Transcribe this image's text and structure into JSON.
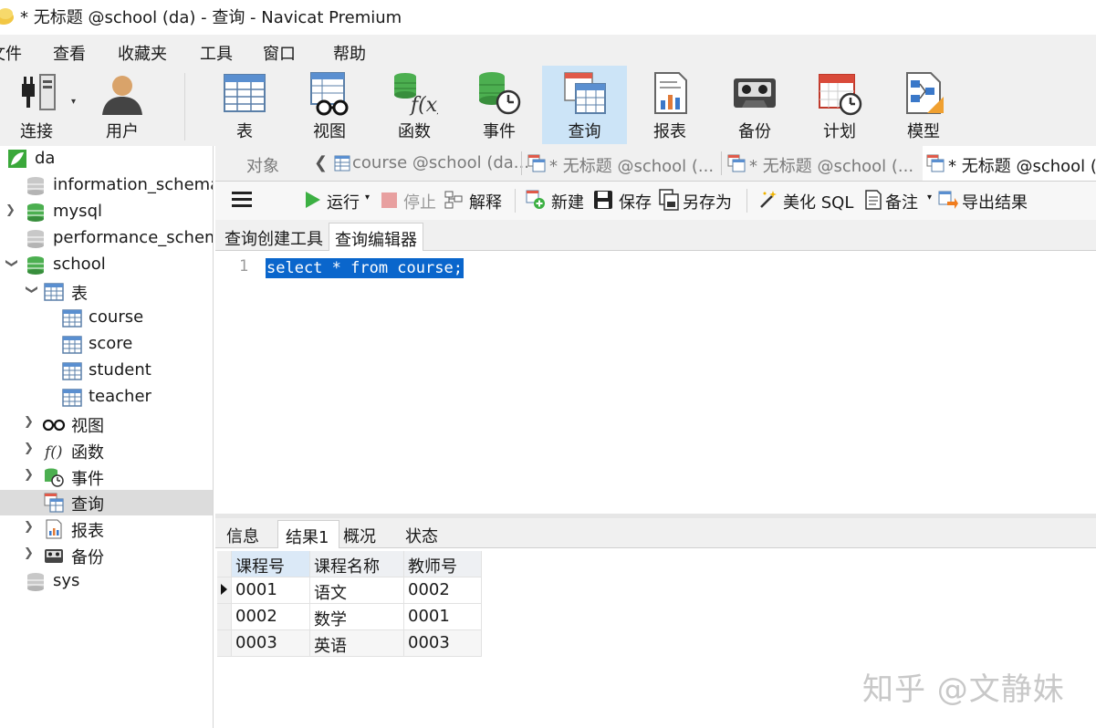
{
  "window": {
    "title": "* 无标题 @school (da) - 查询 - Navicat Premium"
  },
  "menu": [
    "文件",
    "查看",
    "收藏夹",
    "工具",
    "窗口",
    "帮助"
  ],
  "toolbar": {
    "buttons": [
      {
        "label": "连接",
        "icon": "plug-icon"
      },
      {
        "label": "用户",
        "icon": "user-icon"
      },
      {
        "label": "表",
        "icon": "table-icon"
      },
      {
        "label": "视图",
        "icon": "view-glasses-icon"
      },
      {
        "label": "函数",
        "icon": "function-icon"
      },
      {
        "label": "事件",
        "icon": "event-clock-icon"
      },
      {
        "label": "查询",
        "icon": "query-icon",
        "active": true
      },
      {
        "label": "报表",
        "icon": "report-icon"
      },
      {
        "label": "备份",
        "icon": "backup-cassette-icon"
      },
      {
        "label": "计划",
        "icon": "schedule-calendar-icon"
      },
      {
        "label": "模型",
        "icon": "model-icon"
      }
    ]
  },
  "sidebar": {
    "connection": "da",
    "databases": {
      "information_schema": "information_schema",
      "mysql": "mysql",
      "performance_schema": "performance_schema",
      "school": "school",
      "sys": "sys"
    },
    "school_children": {
      "tables_label": "表",
      "tables": [
        "course",
        "score",
        "student",
        "teacher"
      ],
      "views_label": "视图",
      "functions_label": "函数",
      "events_label": "事件",
      "queries_label": "查询",
      "reports_label": "报表",
      "backups_label": "备份"
    }
  },
  "tabs": {
    "objects": "对象",
    "tab1": "course @school (da...",
    "tab2": "* 无标题 @school (...",
    "tab3": "* 无标题 @school (...",
    "tab4": "* 无标题 @school ("
  },
  "query_toolbar": {
    "run": "运行",
    "stop": "停止",
    "explain": "解释",
    "new": "新建",
    "save": "保存",
    "save_as": "另存为",
    "beautify": "美化 SQL",
    "comment": "备注",
    "export": "导出结果"
  },
  "subtabs": {
    "builder": "查询创建工具",
    "editor": "查询编辑器"
  },
  "editor": {
    "line_number": "1",
    "code": "select * from course;"
  },
  "result_tabs": {
    "info": "信息",
    "result1": "结果1",
    "profile": "概况",
    "status": "状态"
  },
  "result_grid": {
    "columns": [
      "课程号",
      "课程名称",
      "教师号"
    ],
    "rows": [
      [
        "0001",
        "语文",
        "0002"
      ],
      [
        "0002",
        "数学",
        "0001"
      ],
      [
        "0003",
        "英语",
        "0003"
      ]
    ]
  },
  "watermark": "知乎 @文静妹",
  "colors": {
    "selection": "#0a66cc",
    "active_toolbar": "#cce4f7",
    "db_green": "#3aa83a"
  }
}
